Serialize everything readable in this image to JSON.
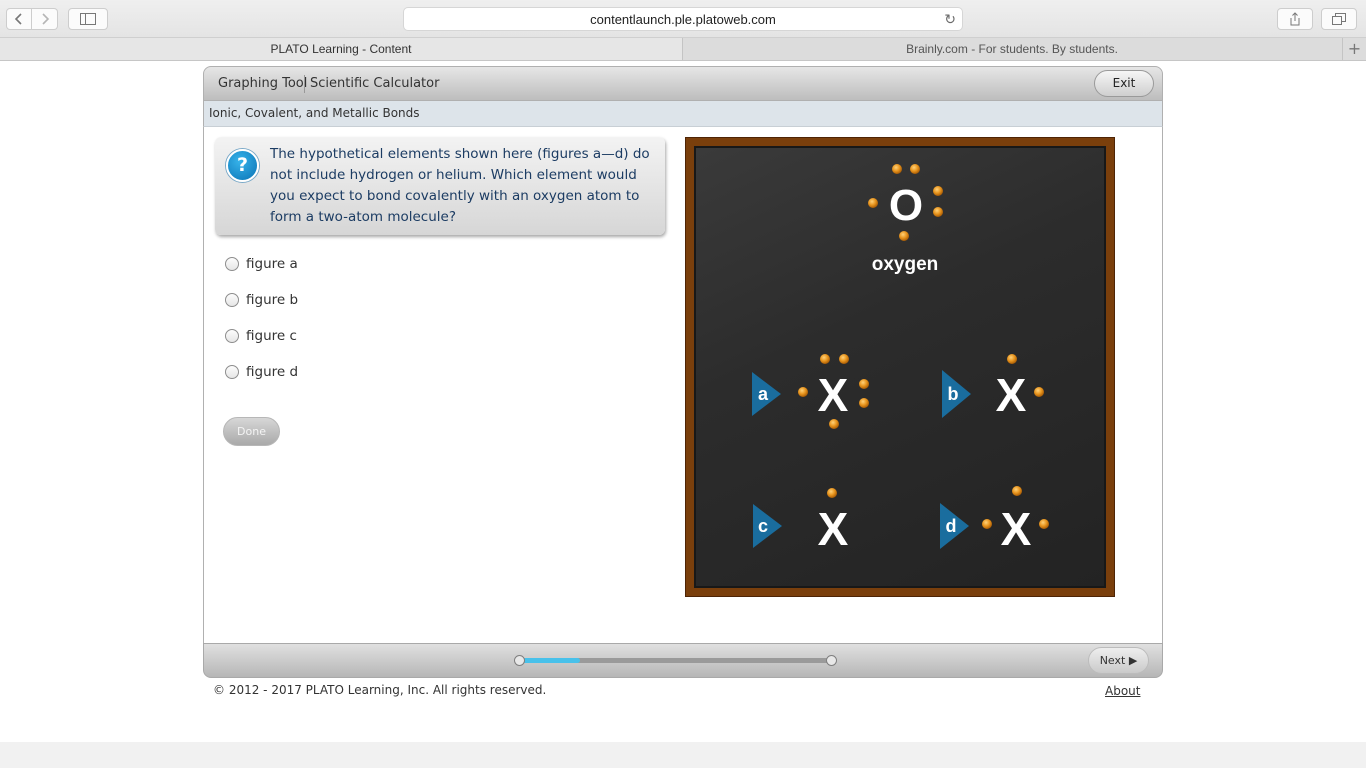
{
  "browser": {
    "url": "contentlaunch.ple.platoweb.com",
    "tabs": [
      {
        "label": "PLATO Learning - Content",
        "active": true
      },
      {
        "label": "Brainly.com - For students. By students.",
        "active": false
      }
    ],
    "icons": {
      "back": "chevron-left-icon",
      "forward": "chevron-right-icon",
      "sidebar": "sidebar-icon",
      "reload": "reload-icon",
      "share": "share-icon",
      "tabs": "tabs-overview-icon",
      "new_tab": "plus-icon"
    }
  },
  "app": {
    "tools": [
      "Graphing Tool",
      "Scientific Calculator"
    ],
    "exit_label": "Exit",
    "lesson_title": "Ionic, Covalent, and Metallic Bonds",
    "question": {
      "icon": "question-icon",
      "text": "The hypothetical elements shown here (figures a—d) do not include hydrogen or helium. Which element would you expect to bond covalently with an oxygen atom to form a two-atom molecule?"
    },
    "options": [
      "figure a",
      "figure b",
      "figure c",
      "figure d"
    ],
    "selected_option": null,
    "done_label": "Done",
    "figure": {
      "oxygen": {
        "symbol": "O",
        "name": "oxygen",
        "valence_electrons": 6
      },
      "elements": [
        {
          "label": "a",
          "symbol": "X",
          "valence_electrons": 6
        },
        {
          "label": "b",
          "symbol": "X",
          "valence_electrons": 2
        },
        {
          "label": "c",
          "symbol": "X",
          "valence_electrons": 1
        },
        {
          "label": "d",
          "symbol": "X",
          "valence_electrons": 3
        }
      ],
      "colors": {
        "board": "#2c2c2c",
        "frame": "#7a3f0c",
        "electron": "#e8951e",
        "marker": "#1a6d9e"
      }
    },
    "progress": 0.2,
    "next_label": "Next ▶",
    "copyright": "© 2012 - 2017 PLATO Learning, Inc. All rights reserved.",
    "about_label": "About"
  }
}
